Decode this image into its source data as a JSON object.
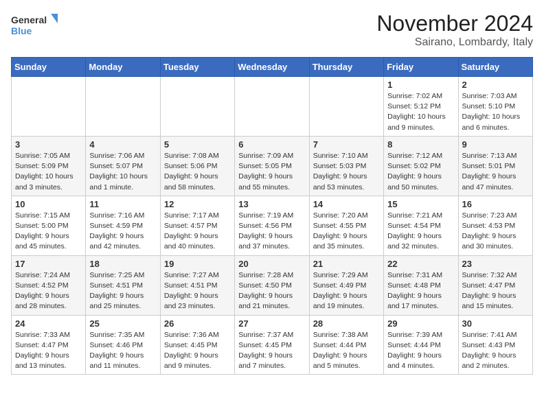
{
  "logo": {
    "line1": "General",
    "line2": "Blue"
  },
  "title": "November 2024",
  "location": "Sairano, Lombardy, Italy",
  "weekdays": [
    "Sunday",
    "Monday",
    "Tuesday",
    "Wednesday",
    "Thursday",
    "Friday",
    "Saturday"
  ],
  "weeks": [
    [
      {
        "day": "",
        "info": ""
      },
      {
        "day": "",
        "info": ""
      },
      {
        "day": "",
        "info": ""
      },
      {
        "day": "",
        "info": ""
      },
      {
        "day": "",
        "info": ""
      },
      {
        "day": "1",
        "info": "Sunrise: 7:02 AM\nSunset: 5:12 PM\nDaylight: 10 hours and 9 minutes."
      },
      {
        "day": "2",
        "info": "Sunrise: 7:03 AM\nSunset: 5:10 PM\nDaylight: 10 hours and 6 minutes."
      }
    ],
    [
      {
        "day": "3",
        "info": "Sunrise: 7:05 AM\nSunset: 5:09 PM\nDaylight: 10 hours and 3 minutes."
      },
      {
        "day": "4",
        "info": "Sunrise: 7:06 AM\nSunset: 5:07 PM\nDaylight: 10 hours and 1 minute."
      },
      {
        "day": "5",
        "info": "Sunrise: 7:08 AM\nSunset: 5:06 PM\nDaylight: 9 hours and 58 minutes."
      },
      {
        "day": "6",
        "info": "Sunrise: 7:09 AM\nSunset: 5:05 PM\nDaylight: 9 hours and 55 minutes."
      },
      {
        "day": "7",
        "info": "Sunrise: 7:10 AM\nSunset: 5:03 PM\nDaylight: 9 hours and 53 minutes."
      },
      {
        "day": "8",
        "info": "Sunrise: 7:12 AM\nSunset: 5:02 PM\nDaylight: 9 hours and 50 minutes."
      },
      {
        "day": "9",
        "info": "Sunrise: 7:13 AM\nSunset: 5:01 PM\nDaylight: 9 hours and 47 minutes."
      }
    ],
    [
      {
        "day": "10",
        "info": "Sunrise: 7:15 AM\nSunset: 5:00 PM\nDaylight: 9 hours and 45 minutes."
      },
      {
        "day": "11",
        "info": "Sunrise: 7:16 AM\nSunset: 4:59 PM\nDaylight: 9 hours and 42 minutes."
      },
      {
        "day": "12",
        "info": "Sunrise: 7:17 AM\nSunset: 4:57 PM\nDaylight: 9 hours and 40 minutes."
      },
      {
        "day": "13",
        "info": "Sunrise: 7:19 AM\nSunset: 4:56 PM\nDaylight: 9 hours and 37 minutes."
      },
      {
        "day": "14",
        "info": "Sunrise: 7:20 AM\nSunset: 4:55 PM\nDaylight: 9 hours and 35 minutes."
      },
      {
        "day": "15",
        "info": "Sunrise: 7:21 AM\nSunset: 4:54 PM\nDaylight: 9 hours and 32 minutes."
      },
      {
        "day": "16",
        "info": "Sunrise: 7:23 AM\nSunset: 4:53 PM\nDaylight: 9 hours and 30 minutes."
      }
    ],
    [
      {
        "day": "17",
        "info": "Sunrise: 7:24 AM\nSunset: 4:52 PM\nDaylight: 9 hours and 28 minutes."
      },
      {
        "day": "18",
        "info": "Sunrise: 7:25 AM\nSunset: 4:51 PM\nDaylight: 9 hours and 25 minutes."
      },
      {
        "day": "19",
        "info": "Sunrise: 7:27 AM\nSunset: 4:51 PM\nDaylight: 9 hours and 23 minutes."
      },
      {
        "day": "20",
        "info": "Sunrise: 7:28 AM\nSunset: 4:50 PM\nDaylight: 9 hours and 21 minutes."
      },
      {
        "day": "21",
        "info": "Sunrise: 7:29 AM\nSunset: 4:49 PM\nDaylight: 9 hours and 19 minutes."
      },
      {
        "day": "22",
        "info": "Sunrise: 7:31 AM\nSunset: 4:48 PM\nDaylight: 9 hours and 17 minutes."
      },
      {
        "day": "23",
        "info": "Sunrise: 7:32 AM\nSunset: 4:47 PM\nDaylight: 9 hours and 15 minutes."
      }
    ],
    [
      {
        "day": "24",
        "info": "Sunrise: 7:33 AM\nSunset: 4:47 PM\nDaylight: 9 hours and 13 minutes."
      },
      {
        "day": "25",
        "info": "Sunrise: 7:35 AM\nSunset: 4:46 PM\nDaylight: 9 hours and 11 minutes."
      },
      {
        "day": "26",
        "info": "Sunrise: 7:36 AM\nSunset: 4:45 PM\nDaylight: 9 hours and 9 minutes."
      },
      {
        "day": "27",
        "info": "Sunrise: 7:37 AM\nSunset: 4:45 PM\nDaylight: 9 hours and 7 minutes."
      },
      {
        "day": "28",
        "info": "Sunrise: 7:38 AM\nSunset: 4:44 PM\nDaylight: 9 hours and 5 minutes."
      },
      {
        "day": "29",
        "info": "Sunrise: 7:39 AM\nSunset: 4:44 PM\nDaylight: 9 hours and 4 minutes."
      },
      {
        "day": "30",
        "info": "Sunrise: 7:41 AM\nSunset: 4:43 PM\nDaylight: 9 hours and 2 minutes."
      }
    ]
  ]
}
